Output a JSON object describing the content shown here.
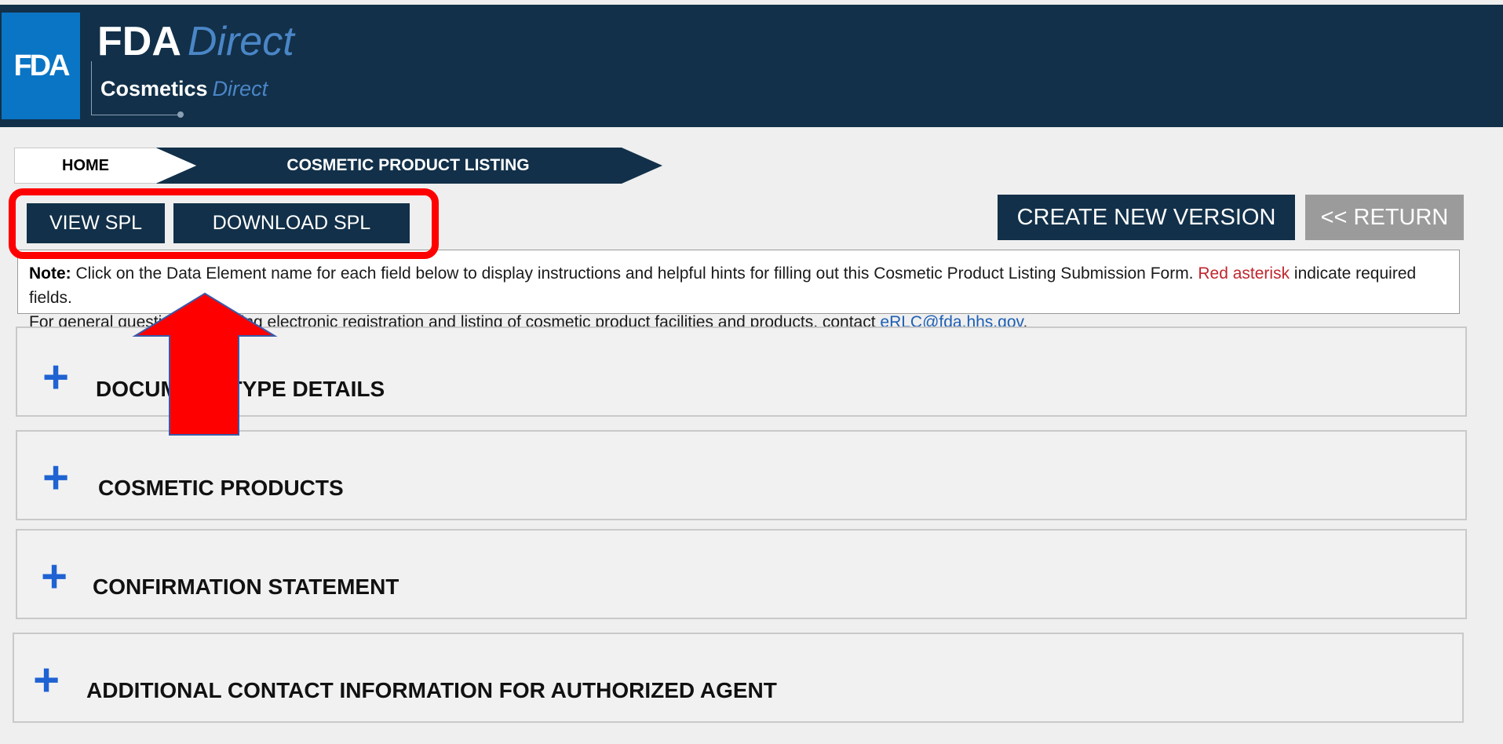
{
  "header": {
    "logo_badge": "FDA",
    "brand_primary": "FDA",
    "brand_primary_accent": "Direct",
    "brand_secondary": "Cosmetics",
    "brand_secondary_accent": "Direct"
  },
  "breadcrumb": {
    "home": "HOME",
    "current": "COSMETIC PRODUCT LISTING"
  },
  "toolbar": {
    "view_spl": "VIEW SPL",
    "download_spl": "DOWNLOAD SPL",
    "create_new_version": "CREATE NEW VERSION",
    "return": "<< RETURN"
  },
  "note": {
    "label": "Note:",
    "text1": " Click on the Data Element name for each field below to display instructions and helpful hints for filling out this Cosmetic Product Listing Submission Form. ",
    "red_text": "Red asterisk",
    "text2": " indicate required fields.",
    "text3": "For general questions regarding electronic registration and listing of cosmetic product facilities and products, contact ",
    "email": "eRLC@fda.hhs.gov",
    "text4": "."
  },
  "sections": [
    {
      "title": "DOCUMENT TYPE DETAILS",
      "icon": "plus-icon"
    },
    {
      "title": "COSMETIC PRODUCTS",
      "icon": "plus-icon"
    },
    {
      "title": "CONFIRMATION STATEMENT",
      "icon": "plus-icon"
    },
    {
      "title": "ADDITIONAL CONTACT INFORMATION FOR AUTHORIZED AGENT",
      "icon": "plus-icon"
    }
  ],
  "colors": {
    "header_bg": "#123049",
    "accent_blue": "#0a75c4",
    "highlight_red": "#ff0000",
    "return_gray": "#9b9b9b",
    "plus_blue": "#1f62d2"
  }
}
